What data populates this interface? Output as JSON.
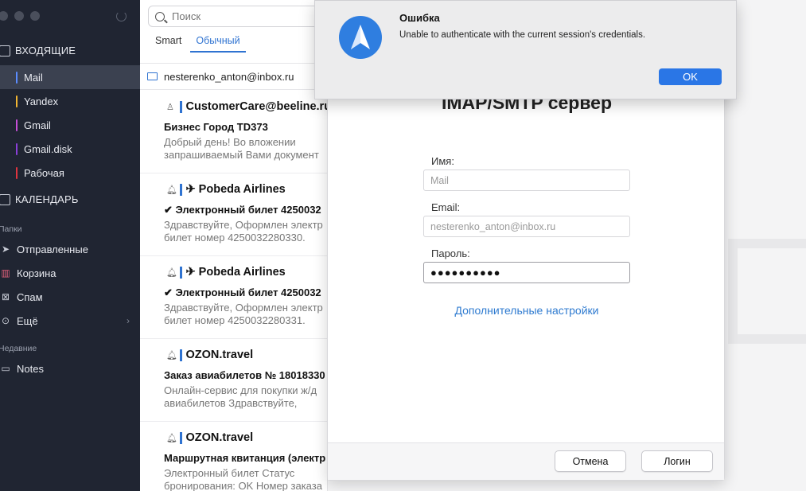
{
  "sidebar": {
    "inbox_label": "ВХОДЯЩИЕ",
    "accounts": [
      {
        "label": "Mail",
        "color": "#5b8cff"
      },
      {
        "label": "Yandex",
        "color": "#f2b632"
      },
      {
        "label": "Gmail",
        "color": "#c64fd8"
      },
      {
        "label": "Gmail.disk",
        "color": "#8a3fd8"
      },
      {
        "label": "Рабочая",
        "color": "#e0343f"
      }
    ],
    "calendar_label": "КАЛЕНДАРЬ",
    "folders_group": "Папки",
    "folders": [
      {
        "label": "Отправленные",
        "icon": "send-icon"
      },
      {
        "label": "Корзина",
        "icon": "trash-icon"
      },
      {
        "label": "Спам",
        "icon": "spam-icon"
      },
      {
        "label": "Ещё",
        "icon": "more-icon"
      }
    ],
    "recent_group": "Недавние",
    "recent": [
      {
        "label": "Notes",
        "icon": "folder-icon"
      }
    ]
  },
  "list": {
    "search_placeholder": "Поиск",
    "tabs": [
      "Smart",
      "Обычный"
    ],
    "account_email": "nesterenko_anton@inbox.ru",
    "messages": [
      {
        "sender": "CustomerCare@beeline.ru",
        "subject": "Бизнес Город TD373",
        "preview1": "Добрый день! Во вложении",
        "preview2": "запрашиваемый Вами документ"
      },
      {
        "sender": "✈ Pobeda Airlines",
        "subject": "✔ Электронный билет 4250032",
        "preview1": "Здравствуйте, Оформлен электр",
        "preview2": "билет номер 4250032280330."
      },
      {
        "sender": "✈ Pobeda Airlines",
        "subject": "✔ Электронный билет 4250032",
        "preview1": "Здравствуйте, Оформлен электр",
        "preview2": "билет номер 4250032280331."
      },
      {
        "sender": "OZON.travel",
        "subject": "Заказ авиабилетов № 18018330",
        "preview1": "Онлайн-сервис для покупки ж/д",
        "preview2": "авиабилетов Здравствуйте,"
      },
      {
        "sender": "OZON.travel",
        "subject": "Маршрутная квитанция (электр",
        "preview1": "Электронный билет Статус",
        "preview2": "бронирования: OK Номер заказа"
      }
    ]
  },
  "sheet": {
    "title": "IMAP/SMTP сервер",
    "name_label": "Имя:",
    "name_value": "Mail",
    "email_label": "Email:",
    "email_value": "nesterenko_anton@inbox.ru",
    "password_label": "Пароль:",
    "password_value": "●●●●●●●●●●",
    "more_settings": "Дополнительные настройки",
    "cancel": "Отмена",
    "login": "Логин"
  },
  "alert": {
    "title": "Ошибка",
    "message": "Unable to authenticate with the current session's credentials.",
    "ok": "OK"
  }
}
